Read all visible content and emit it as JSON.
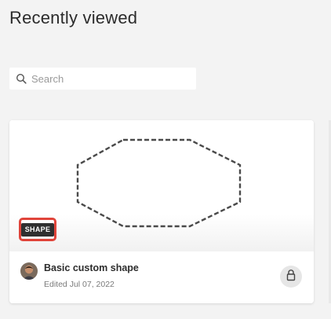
{
  "header": {
    "title": "Recently viewed"
  },
  "search": {
    "placeholder": "Search",
    "value": ""
  },
  "cards": [
    {
      "badge": "SHAPE",
      "title": "Basic custom shape",
      "subtitle": "Edited Jul 07, 2022",
      "icons": {
        "preview": "dashed-octagon-shape",
        "avatar": "user-avatar",
        "action": "lock-icon"
      }
    }
  ],
  "colors": {
    "background": "#f3f3f3",
    "highlight": "#e0443a",
    "badge_bg": "#2f2f2f"
  }
}
